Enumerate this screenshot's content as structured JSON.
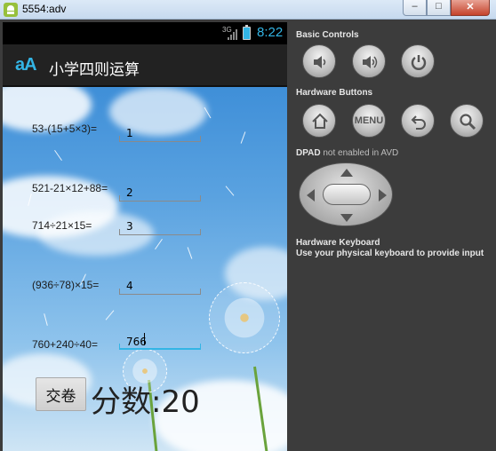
{
  "window": {
    "title": "5554:adv",
    "minimize": "–",
    "maximize": "□",
    "close": "✕"
  },
  "status_bar": {
    "network": "3G",
    "time": "8:22"
  },
  "action_bar": {
    "logo": "aA",
    "title": "小学四则运算"
  },
  "quiz": {
    "questions": [
      {
        "expression": "53-(15+5×3)=",
        "answer": "1"
      },
      {
        "expression": "521-21×12+88=",
        "answer": "2"
      },
      {
        "expression": "714÷21×15=",
        "answer": "3"
      },
      {
        "expression": "(936÷78)×15=",
        "answer": "4"
      },
      {
        "expression": "760+240÷40=",
        "answer": "766"
      }
    ],
    "submit_label": "交卷",
    "score": "分数:20"
  },
  "panel": {
    "basic_controls": "Basic Controls",
    "hardware_buttons": "Hardware Buttons",
    "menu_label": "MENU",
    "dpad_label": "DPAD",
    "dpad_note": "not enabled in AVD",
    "keyboard_title": "Hardware Keyboard",
    "keyboard_note": "Use your physical keyboard to provide input"
  },
  "colors": {
    "accent": "#33b5e5",
    "panel_bg": "#3c3c3c",
    "action_bar": "#222222"
  }
}
